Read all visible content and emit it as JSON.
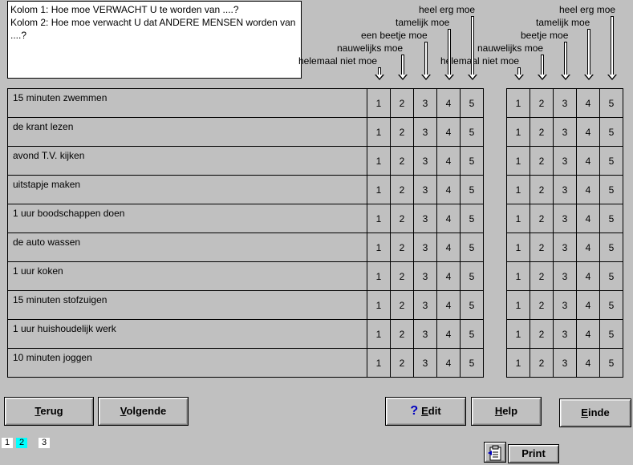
{
  "instructions": {
    "line1": "Kolom 1: Hoe moe VERWACHT U te worden van ....?",
    "line2": "Kolom 2: Hoe moe verwacht U dat ANDERE MENSEN worden van ....?"
  },
  "scale_left": [
    "helemaal niet moe",
    "nauwelijks moe",
    "een beetje moe",
    "tamelijk moe",
    "heel erg moe"
  ],
  "scale_right": [
    "helemaal niet moe",
    "nauwelijks moe",
    "beetje moe",
    "tamelijk moe",
    "heel erg moe"
  ],
  "options": [
    "1",
    "2",
    "3",
    "4",
    "5"
  ],
  "activities": [
    "15 minuten zwemmen",
    "de krant lezen",
    "avond T.V.  kijken",
    "uitstapje maken",
    "1 uur boodschappen doen",
    "de auto wassen",
    "1 uur koken",
    "15 minuten stofzuigen",
    "1 uur huishoudelijk werk",
    "10 minuten joggen"
  ],
  "buttons": {
    "back": {
      "prefix": "",
      "accel": "T",
      "rest": "erug"
    },
    "next": {
      "prefix": "",
      "accel": "V",
      "rest": "olgende"
    },
    "edit": {
      "prefix": "",
      "accel": "E",
      "rest": "dit"
    },
    "help": {
      "prefix": "",
      "accel": "H",
      "rest": "elp"
    },
    "end": {
      "prefix": "",
      "accel": "E",
      "rest": "inde"
    },
    "print": "Print",
    "edit_icon_glyph": "?"
  },
  "pages": [
    {
      "label": "1",
      "active": false,
      "color": "#ffffff"
    },
    {
      "label": "2",
      "active": true,
      "color": "#00ffff"
    },
    {
      "label": "3",
      "active": false,
      "color": "#ffffff"
    }
  ]
}
